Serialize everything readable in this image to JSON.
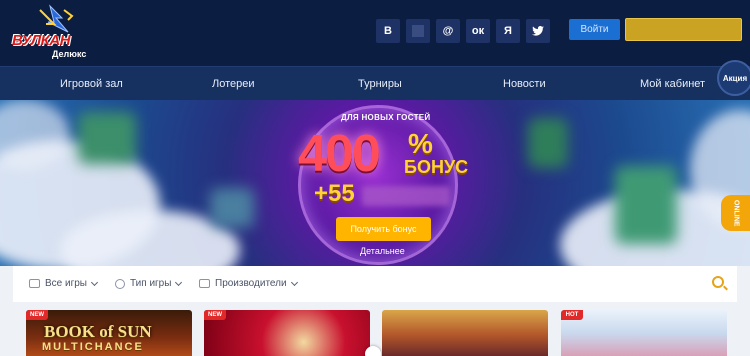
{
  "brand": {
    "logo_word": "ВУЛКАН",
    "logo_sub": "Делюкс"
  },
  "socials": [
    {
      "label": "В",
      "icon": "vk-icon"
    },
    {
      "label": "",
      "icon": "blank-social-icon"
    },
    {
      "label": "@",
      "icon": "mail-icon"
    },
    {
      "label": "ок",
      "icon": "odnoklassniki-icon"
    },
    {
      "label": "Я",
      "icon": "yandex-icon"
    },
    {
      "label": "🐦",
      "icon": "twitter-icon"
    }
  ],
  "auth": {
    "login_label": "Войти"
  },
  "nav": {
    "items": [
      "Игровой зал",
      "Лотереи",
      "Турниры",
      "Новости",
      "Мой кабинет"
    ],
    "promo_badge": "Акция"
  },
  "banner": {
    "small_text": "ДЛЯ НОВЫХ ГОСТЕЙ",
    "big_number": "400",
    "percent": "%",
    "bonus_word": "БОНУС",
    "plus_value": "+55",
    "cta_label": "Получить бонус",
    "more_label": "Детальнее",
    "online_label": "ONLINE"
  },
  "filters": {
    "all_games": "Все игры",
    "game_type": "Тип игры",
    "providers": "Производители"
  },
  "games": [
    {
      "tag": "NEW",
      "title": "BOOK of SUN",
      "subtitle": "MULTICHANCE"
    },
    {
      "tag": "NEW",
      "title": ""
    },
    {
      "tag": "",
      "title": ""
    },
    {
      "tag": "HOT",
      "title": ""
    }
  ],
  "colors": {
    "header_bg": "#0c1d42",
    "nav_bg": "#16305f",
    "login_blue": "#1c6fd2",
    "register_gold": "#c9a321",
    "cta_orange": "#ffb400",
    "accent_red": "#e02a2a"
  }
}
